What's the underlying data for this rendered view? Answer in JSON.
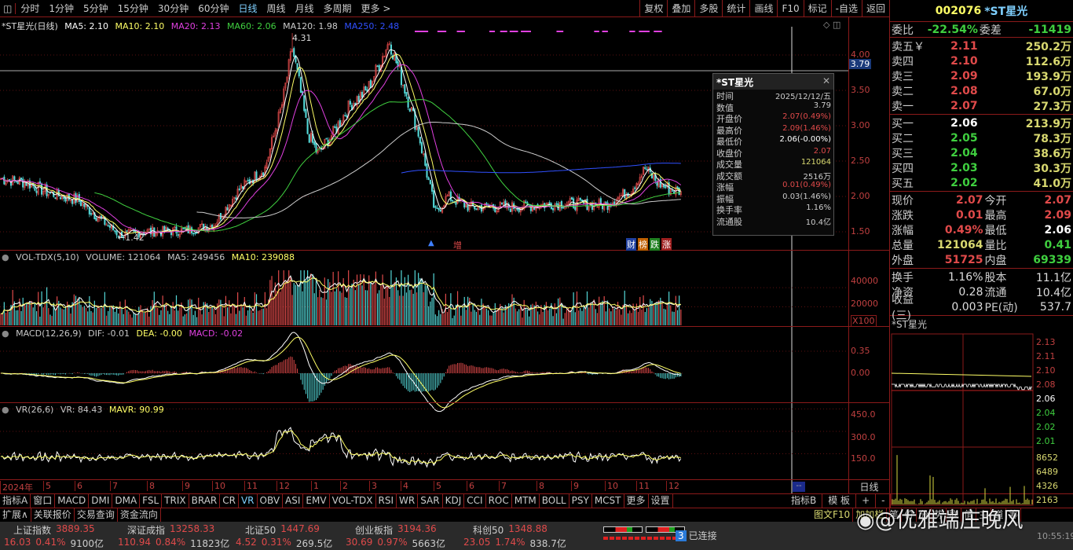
{
  "toolbar": {
    "periods": [
      "分时",
      "1分钟",
      "5分钟",
      "15分钟",
      "30分钟",
      "60分钟",
      "日线",
      "周线",
      "月线",
      "多周期",
      "更多 >"
    ],
    "active": "日线",
    "right_buttons": [
      "复权",
      "叠加",
      "多股",
      "统计",
      "画线",
      "F10",
      "标记",
      "-自选",
      "返回"
    ]
  },
  "stock": {
    "code": "002076",
    "name": "*ST星光"
  },
  "main_legend": {
    "title": "*ST星光(日线)",
    "ma5": "MA5: 2.10",
    "ma10": "MA10: 2.10",
    "ma20": "MA20: 2.13",
    "ma60": "MA60: 2.06",
    "ma120": "MA120: 1.98",
    "ma250": "MA250: 2.48"
  },
  "price_axis": [
    "4.00",
    "3.50",
    "3.00",
    "2.50",
    "2.00",
    "1.50"
  ],
  "crosshair_value": "3.79",
  "marks": {
    "high": "4.31",
    "low": "←1.42",
    "zeng": "增",
    "badges": [
      "财",
      "榜",
      "跌",
      "涨"
    ]
  },
  "colors": {
    "up": "#e04a4a",
    "down": "#54d8d8",
    "ma5": "#ffffff",
    "ma10": "#ffff66",
    "ma20": "#e040e0",
    "ma60": "#40d040",
    "ma120": "#cccccc",
    "ma250": "#3050ff"
  },
  "price_anchors": [
    [
      0,
      2.25
    ],
    [
      15,
      2.2
    ],
    [
      28,
      2.05
    ],
    [
      45,
      1.95
    ],
    [
      60,
      1.65
    ],
    [
      70,
      1.45
    ],
    [
      85,
      1.5
    ],
    [
      110,
      1.52
    ],
    [
      125,
      1.6
    ],
    [
      140,
      2.1
    ],
    [
      155,
      2.4
    ],
    [
      165,
      3.3
    ],
    [
      171,
      4.1
    ],
    [
      175,
      3.6
    ],
    [
      180,
      2.9
    ],
    [
      186,
      2.6
    ],
    [
      195,
      2.9
    ],
    [
      205,
      3.3
    ],
    [
      215,
      3.5
    ],
    [
      228,
      4.2
    ],
    [
      236,
      3.6
    ],
    [
      245,
      2.9
    ],
    [
      255,
      1.75
    ],
    [
      262,
      2.0
    ],
    [
      275,
      1.85
    ],
    [
      300,
      1.85
    ],
    [
      330,
      1.9
    ],
    [
      355,
      1.88
    ],
    [
      370,
      2.1
    ],
    [
      378,
      2.4
    ],
    [
      385,
      2.2
    ],
    [
      392,
      2.1
    ],
    [
      399,
      2.07
    ]
  ],
  "vol_legend": {
    "title": "VOL-TDX(5,10)",
    "volume": "VOLUME: 121064",
    "ma5": "MA5: 249456",
    "ma10": "MA10: 239088"
  },
  "vol_axis": [
    "40000",
    "20000"
  ],
  "vol_unit": "X100",
  "macd_legend": {
    "title": "MACD(12,26,9)",
    "dif": "DIF: -0.01",
    "dea": "DEA: -0.00",
    "macd": "MACD: -0.02"
  },
  "macd_axis": [
    "0.35",
    "0.00"
  ],
  "vr_legend": {
    "title": "VR(26,6)",
    "vr": "VR: 84.43",
    "mavr": "MAVR: 90.99"
  },
  "vr_axis": [
    "450.0",
    "300.0",
    "150.0"
  ],
  "date_axis": [
    "2024年",
    "5",
    "6",
    "7",
    "8",
    "9",
    "10",
    "11",
    "12",
    "1",
    "2",
    "3",
    "4",
    "5",
    "6",
    "7",
    "8",
    "9",
    "10",
    "11",
    "12"
  ],
  "date_cursor": "--",
  "period_label": "日线",
  "tooltip": {
    "title": "*ST星光",
    "rows": [
      [
        "时间",
        "2025/12/12/五"
      ],
      [
        "数值",
        "3.79"
      ],
      [
        "开盘价",
        "2.07(0.49%)"
      ],
      [
        "最高价",
        "2.09(1.46%)"
      ],
      [
        "最低价",
        "2.06(-0.00%)"
      ],
      [
        "收盘价",
        "2.07"
      ],
      [
        "成交量",
        "121064"
      ],
      [
        "成交额",
        "2516万"
      ],
      [
        "涨幅",
        "0.01(0.49%)"
      ],
      [
        "振幅",
        "0.03(1.46%)"
      ],
      [
        "换手率",
        "1.16%"
      ],
      [
        "流通股",
        "10.4亿"
      ]
    ]
  },
  "orderbook": {
    "wei_bi_label": "委比",
    "wei_bi": "-22.54%",
    "wei_cha_label": "委差",
    "wei_cha": "-11419",
    "asks": [
      [
        "卖五￥",
        "2.11",
        "250.2万"
      ],
      [
        "卖四",
        "2.10",
        "112.6万"
      ],
      [
        "卖三",
        "2.09",
        "193.9万"
      ],
      [
        "卖二",
        "2.08",
        "67.0万"
      ],
      [
        "卖一",
        "2.07",
        "27.3万"
      ]
    ],
    "bids": [
      [
        "买一",
        "2.06",
        "213.9万"
      ],
      [
        "买二",
        "2.05",
        "78.3万"
      ],
      [
        "买三",
        "2.04",
        "38.6万"
      ],
      [
        "买四",
        "2.03",
        "30.3万"
      ],
      [
        "买五",
        "2.02",
        "41.0万"
      ]
    ]
  },
  "stats": [
    [
      "现价",
      "2.07",
      "今开",
      "2.07"
    ],
    [
      "涨跌",
      "0.01",
      "最高",
      "2.09"
    ],
    [
      "涨幅",
      "0.49%",
      "最低",
      "2.06"
    ],
    [
      "总量",
      "121064",
      "量比",
      "0.41"
    ],
    [
      "外盘",
      "51725",
      "内盘",
      "69339"
    ]
  ],
  "fund": [
    [
      "换手",
      "1.16%",
      "股本",
      "11.1亿"
    ],
    [
      "净资",
      "0.28",
      "流通",
      "10.4亿"
    ],
    [
      "收益(三)",
      "0.003",
      "PE(动)",
      "537.7"
    ]
  ],
  "intraday": {
    "title": "*ST星光",
    "price_axis": [
      "2.13",
      "2.11",
      "2.10",
      "2.08",
      "2.06",
      "2.04",
      "2.02",
      "2.01"
    ],
    "vol_axis": [
      "8652",
      "6489",
      "4326",
      "2163"
    ]
  },
  "indicator_tabs": [
    "指标A",
    "窗口",
    "MACD",
    "DMI",
    "DMA",
    "FSL",
    "TRIX",
    "BRAR",
    "CR",
    "VR",
    "OBV",
    "ASI",
    "EMV",
    "VOL-TDX",
    "RSI",
    "WR",
    "SAR",
    "KDJ",
    "CCI",
    "ROC",
    "MTM",
    "BOLL",
    "PSY",
    "MCST",
    "更多",
    "设置"
  ],
  "indicator_active": "VR",
  "right_tabs": [
    "指标B",
    "模 板",
    "+",
    "-"
  ],
  "ext_tabs": [
    "扩展∧",
    "关联报价",
    "交易查询",
    "资金流向"
  ],
  "right_ext_tabs": [
    "图文F10",
    "加加栏",
    "笔",
    "价",
    "分",
    "势",
    "联",
    "值",
    "主",
    "道",
    "筹"
  ],
  "indices": [
    {
      "name": "上证指数",
      "value": "3889.35",
      "chg": "16.03",
      "pct": "0.41%",
      "amt": "9100亿"
    },
    {
      "name": "深证成指",
      "value": "13258.33",
      "chg": "110.94",
      "pct": "0.84%",
      "amt": "11823亿"
    },
    {
      "name": "北证50",
      "value": "1447.69",
      "chg": "4.52",
      "pct": "0.31%",
      "amt": "269.5亿"
    },
    {
      "name": "创业板指",
      "value": "3194.36",
      "chg": "30.69",
      "pct": "0.97%",
      "amt": "5663亿"
    },
    {
      "name": "科创50",
      "value": "1348.88",
      "chg": "23.05",
      "pct": "1.74%",
      "amt": "838.7亿"
    }
  ],
  "connection": {
    "count": "3",
    "label": "已连接"
  },
  "watermark": "@优雅端庄晚风",
  "clock": "10:55:19"
}
